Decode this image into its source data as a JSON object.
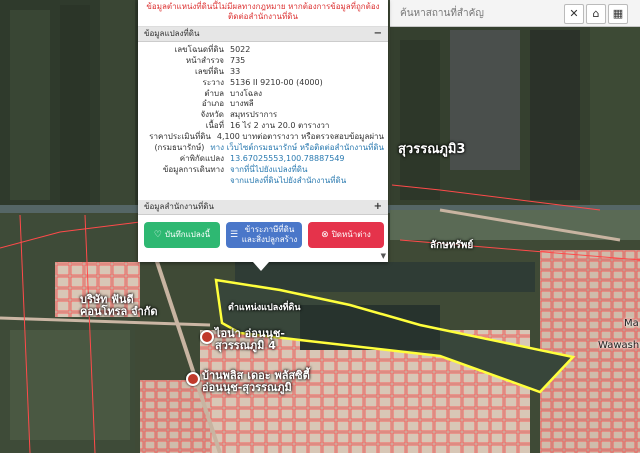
{
  "popup": {
    "warning_text": "ข้อมูลตำแหน่งที่ดินนี้ไม่มีผลทางกฎหมาย หากต้องการข้อมูลที่ถูกต้องติดต่อสำนักงานที่ดิน",
    "section_parcel": "ข้อมูลแปลงที่ดิน",
    "section_parcel_toggle": "−",
    "section_office": "ข้อมูลสำนักงานที่ดิน",
    "section_office_toggle": "+",
    "rows": [
      {
        "label": "เลขโฉนดที่ดิน",
        "value": "5022"
      },
      {
        "label": "หน้าสำรวจ",
        "value": "735"
      },
      {
        "label": "เลขที่ดิน",
        "value": "33"
      },
      {
        "label": "ระวาง",
        "value": "5136 II 9210-00 (4000)"
      },
      {
        "label": "ตำบล",
        "value": "บางโฉลง"
      },
      {
        "label": "อำเภอ",
        "value": "บางพลี"
      },
      {
        "label": "จังหวัด",
        "value": "สมุทรปราการ"
      },
      {
        "label": "เนื้อที่",
        "value": "16 ไร่ 2 งาน 20.0 ตารางวา"
      },
      {
        "label": "ราคาประเมินที่ดิน",
        "value": "4,100 บาทต่อตารางวา หรือตรวจสอบข้อมูลผ่าน"
      },
      {
        "label": "(กรมธนารักษ์)",
        "value": "ทาง เว็บไซต์กรมธนารักษ์ หรือติดต่อสำนักงานที่ดิน"
      },
      {
        "label": "ค่าพิกัดแปลง",
        "value": "13.67025553,100.78887549"
      },
      {
        "label": "ข้อมูลการเดินทาง",
        "value": "จากที่นี่ไปยังแปลงที่ดิน"
      },
      {
        "label": "",
        "value": "จากแปลงที่ดินไปยังสำนักงานที่ดิน"
      }
    ],
    "buttons": {
      "save": "บันทึกแปลงนี้",
      "register": "ข้าระภาษีที่ดินและสิ่งปลูกสร้าง",
      "close": "ปิดหน้าต่าง"
    },
    "scroll_arrow": "▼"
  },
  "topbar": {
    "search_placeholder": "ค้นหาสถานที่สำคัญ"
  },
  "map": {
    "parcel_label": "ตำแหน่งแปลงที่ดิน",
    "label_company": "บริษัท ฟันดี คอนโทรล จำกัด",
    "label_village1": "ไอน่า อ่อนนุช-สุวรรณภูมิ 4",
    "label_village2": "บ้านพลิส เดอะ พลัสซิตี้ อ่อนนุช-สุวรรณภูมิ",
    "label_road": "สุวรรณภูมิ3",
    "label_sap": "ลักษทรัพย์",
    "label_wawash": "Wawash",
    "label_ma": "Ma",
    "parcel_outline_color": "#ffff3c",
    "lot_line_color": "#ff4a4a"
  }
}
